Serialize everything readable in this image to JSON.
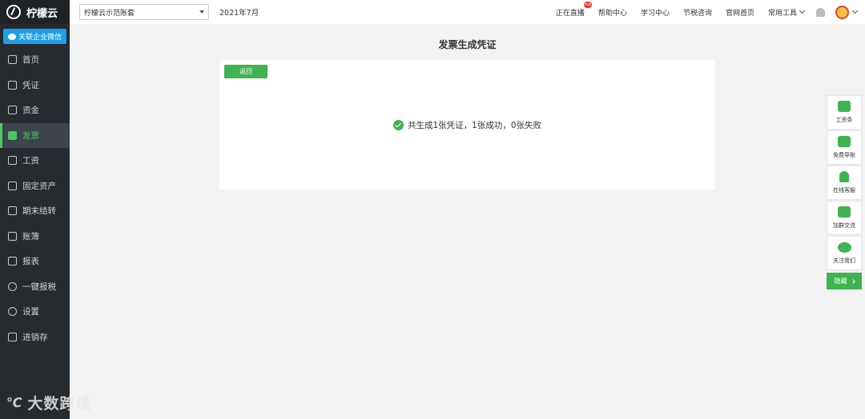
{
  "app": {
    "name": "柠檬云"
  },
  "sidebar": {
    "wechat_button": "关联企业微信",
    "items": [
      {
        "label": "首页",
        "active": false
      },
      {
        "label": "凭证",
        "active": false
      },
      {
        "label": "资金",
        "active": false
      },
      {
        "label": "发票",
        "active": true
      },
      {
        "label": "工资",
        "active": false
      },
      {
        "label": "固定资产",
        "active": false
      },
      {
        "label": "期末结转",
        "active": false
      },
      {
        "label": "账簿",
        "active": false
      },
      {
        "label": "报表",
        "active": false
      },
      {
        "label": "一键报税",
        "active": false
      },
      {
        "label": "设置",
        "active": false
      },
      {
        "label": "进销存",
        "active": false
      }
    ]
  },
  "watermark": {
    "text": "大数跨境"
  },
  "topbar": {
    "account": "柠檬云示范账套",
    "period": "2021年7月",
    "links": [
      "正在直播",
      "帮助中心",
      "学习中心",
      "节税咨询",
      "官网首页"
    ],
    "hot_badge": "hot",
    "tools": "常用工具"
  },
  "main": {
    "title": "发票生成凭证",
    "back_button": "返回",
    "result_text": "共生成1张凭证，1张成功，0张失败"
  },
  "side_panel": {
    "items": [
      "工资条",
      "免费导账",
      "在线客服",
      "加群交流",
      "关注我们"
    ],
    "hide_label": "隐藏"
  },
  "colors": {
    "accent": "#3fb34f",
    "sidebar_bg": "#262b30",
    "wechat": "#1aa0e8"
  }
}
